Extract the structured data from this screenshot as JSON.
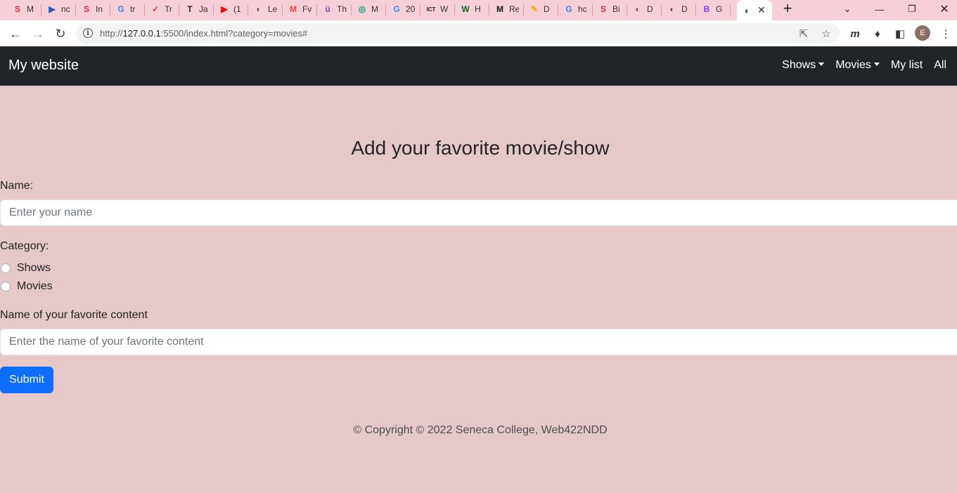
{
  "browser": {
    "tabs": [
      {
        "icon": "S",
        "title": "M",
        "color": "#d32f2f"
      },
      {
        "icon": "▶",
        "title": "nc",
        "color": "#1565c0"
      },
      {
        "icon": "S",
        "title": "In",
        "color": "#d32f2f"
      },
      {
        "icon": "G",
        "title": "tr",
        "color": "#4285f4"
      },
      {
        "icon": "✓",
        "title": "Tr",
        "color": "#e53935"
      },
      {
        "icon": "T",
        "title": "Ja",
        "color": "#212121"
      },
      {
        "icon": "▶",
        "title": "(1",
        "color": "#ff0000"
      },
      {
        "icon": "◐",
        "title": "Le",
        "color": "#555555"
      },
      {
        "icon": "M",
        "title": "Fv",
        "color": "#ea4335"
      },
      {
        "icon": "ü",
        "title": "Th",
        "color": "#8e44ad"
      },
      {
        "icon": "◎",
        "title": "M",
        "color": "#10a37f"
      },
      {
        "icon": "G",
        "title": "20",
        "color": "#4285f4"
      },
      {
        "icon": "ICT",
        "title": "W",
        "color": "#222222"
      },
      {
        "icon": "W",
        "title": "H",
        "color": "#1b5e20"
      },
      {
        "icon": "M",
        "title": "Re",
        "color": "#111111"
      },
      {
        "icon": "✎",
        "title": "D",
        "color": "#f9a825"
      },
      {
        "icon": "G",
        "title": "hc",
        "color": "#4285f4"
      },
      {
        "icon": "S",
        "title": "Bi",
        "color": "#d32f2f"
      },
      {
        "icon": "◐",
        "title": "D",
        "color": "#555555"
      },
      {
        "icon": "◐",
        "title": "D",
        "color": "#555555"
      },
      {
        "icon": "B",
        "title": "G",
        "color": "#7c3aed"
      }
    ],
    "active_tab": {
      "icon": "◐",
      "close": "✕"
    },
    "new_tab": "+",
    "url_prefix": "http://",
    "url_host": "127.0.0.1",
    "url_rest": ":5500/index.html?category=movies#",
    "avatar_initial": "E"
  },
  "site": {
    "brand": "My website",
    "nav": {
      "shows": "Shows",
      "movies": "Movies",
      "my_list": "My list",
      "all": "All"
    }
  },
  "form": {
    "heading": "Add your favorite movie/show",
    "name_label": "Name:",
    "name_placeholder": "Enter your name",
    "category_label": "Category:",
    "category_options": {
      "shows": "Shows",
      "movies": "Movies"
    },
    "content_label": "Name of your favorite content",
    "content_placeholder": "Enter the name of your favorite content",
    "submit": "Submit"
  },
  "footer": "© Copyright © 2022 Seneca College, Web422NDD"
}
